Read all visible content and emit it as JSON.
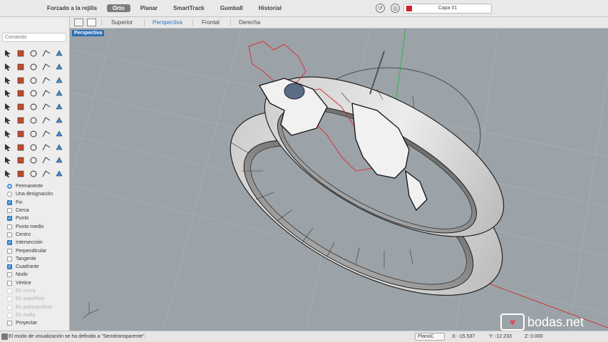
{
  "toolbar": {
    "modes": [
      {
        "label": "Forzado a la rejilla",
        "active": false
      },
      {
        "label": "Orto",
        "active": true
      },
      {
        "label": "Planar",
        "active": false
      },
      {
        "label": "SmartTrack",
        "active": false
      },
      {
        "label": "Gumball",
        "active": false
      },
      {
        "label": "Historial",
        "active": false
      }
    ],
    "layer": {
      "name": "Capa 01",
      "color": "#d51e26"
    }
  },
  "command": {
    "placeholder": "Comando"
  },
  "view_tabs": [
    "Superior",
    "Perspectiva",
    "Frontal",
    "Derecha"
  ],
  "active_view": "Perspectiva",
  "viewport": {
    "label": "Perspectiva"
  },
  "osnap": {
    "modes": [
      {
        "label": "Permanente",
        "type": "radio",
        "checked": true
      },
      {
        "label": "Una designación",
        "type": "radio",
        "checked": false
      }
    ],
    "items": [
      {
        "label": "Fin",
        "checked": true,
        "enabled": true
      },
      {
        "label": "Cerca",
        "checked": false,
        "enabled": true
      },
      {
        "label": "Punto",
        "checked": true,
        "enabled": true
      },
      {
        "label": "Punto medio",
        "checked": false,
        "enabled": true
      },
      {
        "label": "Centro",
        "checked": false,
        "enabled": true
      },
      {
        "label": "Intersección",
        "checked": true,
        "enabled": true
      },
      {
        "label": "Perpendicular",
        "checked": false,
        "enabled": true
      },
      {
        "label": "Tangente",
        "checked": false,
        "enabled": true
      },
      {
        "label": "Cuadrante",
        "checked": true,
        "enabled": true
      },
      {
        "label": "Nodo",
        "checked": false,
        "enabled": true
      },
      {
        "label": "Vértice",
        "checked": false,
        "enabled": true
      },
      {
        "label": "En curva",
        "checked": false,
        "enabled": false
      },
      {
        "label": "En superficie",
        "checked": false,
        "enabled": false
      },
      {
        "label": "En polisuperficie",
        "checked": false,
        "enabled": false
      },
      {
        "label": "En malla",
        "checked": false,
        "enabled": false
      },
      {
        "label": "Proyectar",
        "checked": false,
        "enabled": true
      }
    ]
  },
  "status": {
    "message": "El modo de visualización se ha definido a \"Semitransparente\".",
    "cplane": "PlanoC",
    "x": "X: -15.537",
    "y": "Y: -12.233",
    "z": "Z: 0.000"
  },
  "watermark": {
    "text": "bodas.net"
  }
}
